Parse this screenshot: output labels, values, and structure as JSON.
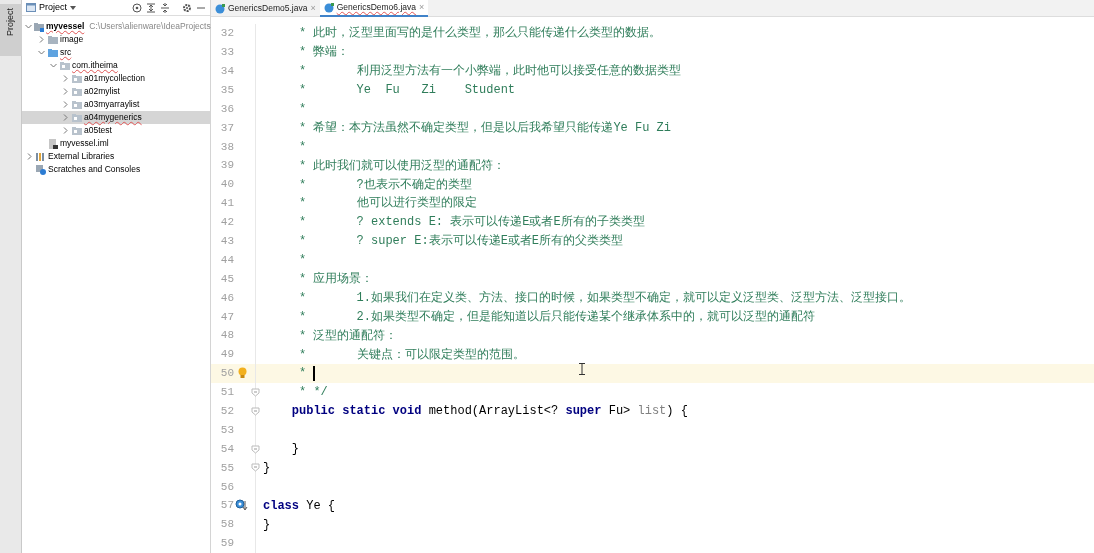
{
  "tool_stripe": {
    "label": "Project"
  },
  "project_panel": {
    "title": "Project",
    "tree": [
      {
        "label": "myvessel",
        "path": "C:\\Users\\alienware\\IdeaProjects",
        "kind": "module",
        "expanded": true,
        "selected": false,
        "children": [
          {
            "label": "image",
            "kind": "folder",
            "expanded": false,
            "selected": false
          },
          {
            "label": "src",
            "kind": "source",
            "expanded": true,
            "selected": false,
            "children": [
              {
                "label": "com.itheima",
                "kind": "package",
                "expanded": true,
                "selected": false,
                "children": [
                  {
                    "label": "a01mycollection",
                    "kind": "package",
                    "expanded": false,
                    "selected": false
                  },
                  {
                    "label": "a02mylist",
                    "kind": "package",
                    "expanded": false,
                    "selected": false
                  },
                  {
                    "label": "a03myarraylist",
                    "kind": "package",
                    "expanded": false,
                    "selected": false
                  },
                  {
                    "label": "a04mygenerics",
                    "kind": "package",
                    "expanded": false,
                    "selected": true
                  },
                  {
                    "label": "a05test",
                    "kind": "package",
                    "expanded": false,
                    "selected": false
                  }
                ]
              }
            ]
          },
          {
            "label": "myvessel.iml",
            "kind": "file",
            "selected": false
          }
        ]
      },
      {
        "label": "External Libraries",
        "kind": "libraries",
        "expanded": false,
        "selected": false
      },
      {
        "label": "Scratches and Consoles",
        "kind": "scratches",
        "selected": false
      }
    ]
  },
  "tabs": [
    {
      "label": "GenericsDemo5.java",
      "close": "×",
      "selected": false
    },
    {
      "label": "GenericsDemo6.java",
      "close": "×",
      "selected": true
    }
  ],
  "editor": {
    "lines": [
      {
        "number": "32",
        "tokens": [
          {
            "kind": "comment",
            "text": "     * 此时，泛型里面写的是什么类型，那么只能传递什么类型的数据。"
          }
        ]
      },
      {
        "number": "33",
        "tokens": [
          {
            "kind": "comment",
            "text": "     * 弊端："
          }
        ]
      },
      {
        "number": "34",
        "tokens": [
          {
            "kind": "comment",
            "text": "     *       利用泛型方法有一个小弊端，此时他可以接受任意的数据类型"
          }
        ]
      },
      {
        "number": "35",
        "tokens": [
          {
            "kind": "comment",
            "text": "     *       Ye  Fu   Zi    Student"
          }
        ]
      },
      {
        "number": "36",
        "tokens": [
          {
            "kind": "comment",
            "text": "     *"
          }
        ]
      },
      {
        "number": "37",
        "tokens": [
          {
            "kind": "comment",
            "text": "     * 希望：本方法虽然不确定类型，但是以后我希望只能传递Ye Fu Zi"
          }
        ]
      },
      {
        "number": "38",
        "tokens": [
          {
            "kind": "comment",
            "text": "     *"
          }
        ]
      },
      {
        "number": "39",
        "tokens": [
          {
            "kind": "comment",
            "text": "     * 此时我们就可以使用泛型的通配符："
          }
        ]
      },
      {
        "number": "40",
        "tokens": [
          {
            "kind": "comment",
            "text": "     *       ?也表示不确定的类型"
          }
        ]
      },
      {
        "number": "41",
        "tokens": [
          {
            "kind": "comment",
            "text": "     *       他可以进行类型的限定"
          }
        ]
      },
      {
        "number": "42",
        "tokens": [
          {
            "kind": "comment",
            "text": "     *       ? extends E: 表示可以传递E或者E所有的子类类型"
          }
        ]
      },
      {
        "number": "43",
        "tokens": [
          {
            "kind": "comment",
            "text": "     *       ? super E:表示可以传递E或者E所有的父类类型"
          }
        ]
      },
      {
        "number": "44",
        "tokens": [
          {
            "kind": "comment",
            "text": "     *"
          }
        ]
      },
      {
        "number": "45",
        "tokens": [
          {
            "kind": "comment",
            "text": "     * 应用场景："
          }
        ]
      },
      {
        "number": "46",
        "tokens": [
          {
            "kind": "comment",
            "text": "     *       1.如果我们在定义类、方法、接口的时候，如果类型不确定，就可以定义泛型类、泛型方法、泛型接口。"
          }
        ]
      },
      {
        "number": "47",
        "tokens": [
          {
            "kind": "comment",
            "text": "     *       2.如果类型不确定，但是能知道以后只能传递某个继承体系中的，就可以泛型的通配符"
          }
        ]
      },
      {
        "number": "48",
        "tokens": [
          {
            "kind": "comment",
            "text": "     * 泛型的通配符："
          }
        ]
      },
      {
        "number": "49",
        "tokens": [
          {
            "kind": "comment",
            "text": "     *       关键点：可以限定类型的范围。"
          }
        ]
      },
      {
        "number": "50",
        "current": true,
        "caret": true,
        "bulb": true,
        "tokens": [
          {
            "kind": "comment",
            "text": "     * "
          }
        ]
      },
      {
        "number": "51",
        "foldable": true,
        "tokens": [
          {
            "kind": "comment",
            "text": "     * */"
          }
        ]
      },
      {
        "number": "52",
        "foldable": true,
        "tokens": [
          {
            "kind": "keyword",
            "text": "    public static void"
          },
          {
            "kind": "plain",
            "text": " method(ArrayList<? "
          },
          {
            "kind": "keyword",
            "text": "super"
          },
          {
            "kind": "plain",
            "text": " Fu> "
          },
          {
            "kind": "unused",
            "text": "list"
          },
          {
            "kind": "plain",
            "text": ") {"
          }
        ]
      },
      {
        "number": "53"
      },
      {
        "number": "54",
        "foldable": true,
        "tokens": [
          {
            "kind": "plain",
            "text": "    }"
          }
        ]
      },
      {
        "number": "55",
        "foldable": true,
        "tokens": [
          {
            "kind": "plain",
            "text": "}"
          }
        ]
      },
      {
        "number": "56"
      },
      {
        "number": "57",
        "implemented": true,
        "tokens": [
          {
            "kind": "keyword",
            "text": "class"
          },
          {
            "kind": "plain",
            "text": " Ye {"
          }
        ]
      },
      {
        "number": "58",
        "tokens": [
          {
            "kind": "plain",
            "text": "}"
          }
        ]
      },
      {
        "number": "59"
      }
    ]
  }
}
